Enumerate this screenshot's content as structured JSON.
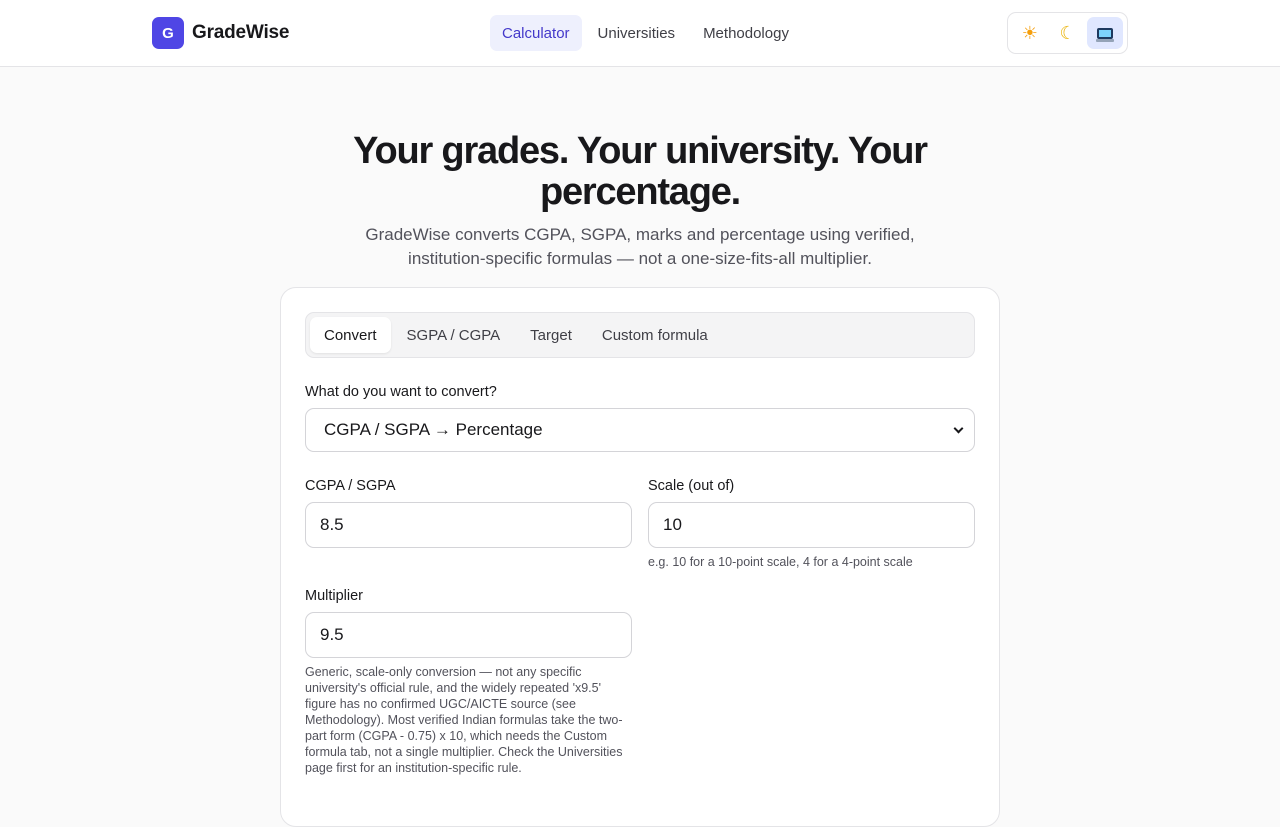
{
  "header": {
    "logo_letter": "G",
    "brand_name": "GradeWise",
    "nav": [
      "Calculator",
      "Universities",
      "Methodology"
    ],
    "active_nav": "Calculator",
    "theme_options": [
      {
        "name": "light",
        "icon": "sun-icon"
      },
      {
        "name": "dark",
        "icon": "moon-icon"
      },
      {
        "name": "system",
        "icon": "monitor-icon"
      }
    ],
    "active_theme": "system"
  },
  "hero": {
    "title": "Your grades. Your university. Your percentage.",
    "subtitle": "GradeWise converts CGPA, SGPA, marks and percentage using verified, institution-specific formulas — not a one-size-fits-all multiplier."
  },
  "calculator": {
    "tabs": [
      "Convert",
      "SGPA / CGPA",
      "Target",
      "Custom formula"
    ],
    "active_tab": "Convert",
    "conversion_label": "What do you want to convert?",
    "conversion_value": "CGPA / SGPA → Percentage",
    "cgpa_label": "CGPA / SGPA",
    "cgpa_value": "8.5",
    "scale_label": "Scale (out of)",
    "scale_value": "10",
    "scale_hint": "e.g. 10 for a 10-point scale, 4 for a 4-point scale",
    "multiplier_label": "Multiplier",
    "multiplier_value": "9.5",
    "multiplier_hint": "Generic, scale-only conversion — not any specific university's official rule, and the widely repeated 'x9.5' figure has no confirmed UGC/AICTE source (see Methodology). Most verified Indian formulas take the two-part form (CGPA - 0.75) x 10, which needs the Custom formula tab, not a single multiplier. Check the Universities page first for an institution-specific rule."
  }
}
